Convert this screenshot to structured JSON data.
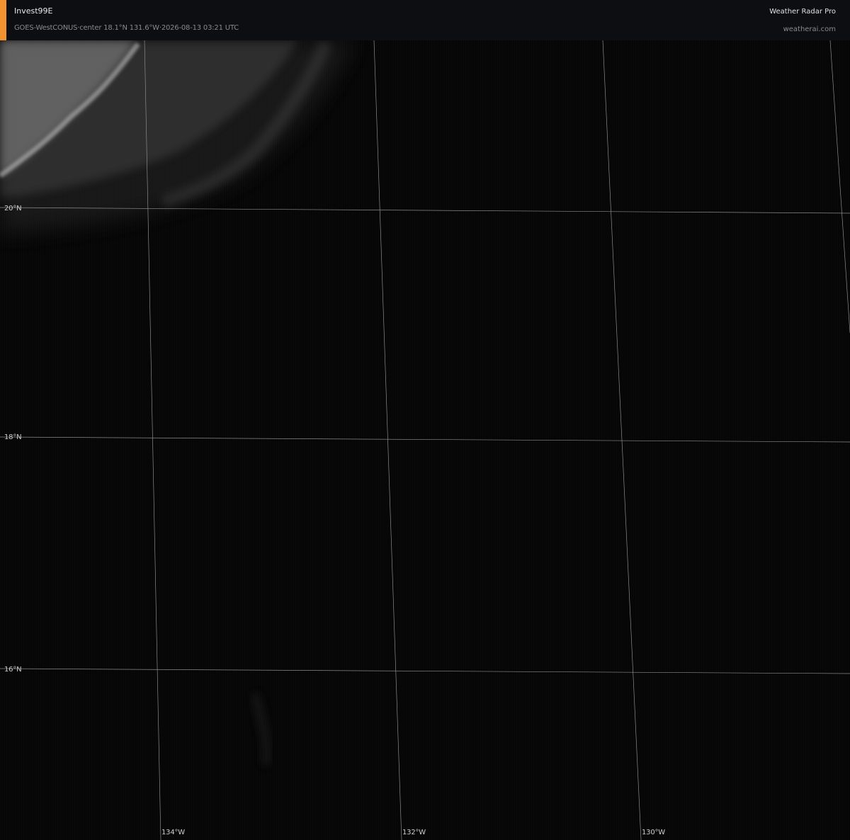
{
  "header": {
    "storm_name": "Invest99E",
    "subtitle": "GOES-WestCONUS·center 18.1°N 131.6°W·2026-08-13 03:21 UTC",
    "brand": "Weather Radar Pro",
    "website": "weatherai.com",
    "accent_color": "#f0922f"
  },
  "map": {
    "imagery": "satellite-infrared",
    "grid_color": "#8c8c8c",
    "latitude_labels": [
      "20°N",
      "18°N",
      "16°N"
    ],
    "longitude_labels": [
      "134°W",
      "132°W",
      "130°W"
    ],
    "features": [
      "cloud-band-northwest"
    ]
  }
}
